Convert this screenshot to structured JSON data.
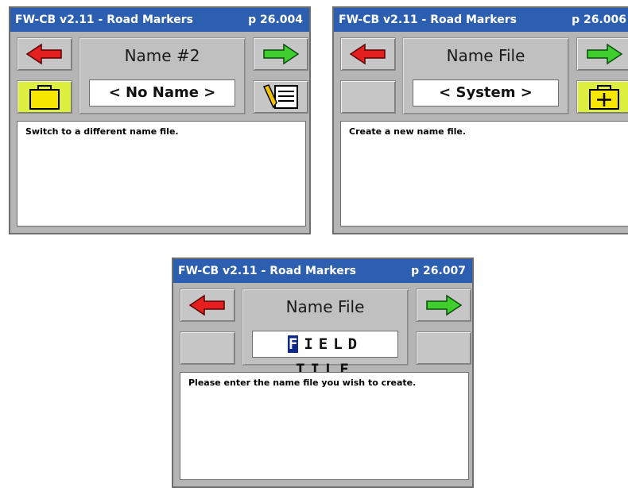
{
  "screens": [
    {
      "title": "FW-CB v2.11 - Road Markers",
      "page": "p 26.004",
      "heading": "Name #2",
      "field_value": "< No Name >",
      "description": "Switch to a different name file.",
      "left_icon": "folder-icon",
      "right_icon": "notepad-edit-icon"
    },
    {
      "title": "FW-CB v2.11 - Road Markers",
      "page": "p 26.006",
      "heading": "Name File",
      "field_value": "< System >",
      "description": "Create a new name file.",
      "left_icon": "",
      "right_icon": "add-folder-icon"
    },
    {
      "title": "FW-CB v2.11 - Road Markers",
      "page": "p 26.007",
      "heading": "Name File",
      "entry_cursor_char": "F",
      "entry_rest": "IELD TILE",
      "description": "Please enter the name file you wish to create."
    }
  ],
  "colors": {
    "titlebar": "#2d5fb1",
    "back_arrow": "#e31f1f",
    "next_arrow": "#3ecf2e",
    "yellow_button": "#dcef3f",
    "cursor": "#0b2a8c"
  }
}
